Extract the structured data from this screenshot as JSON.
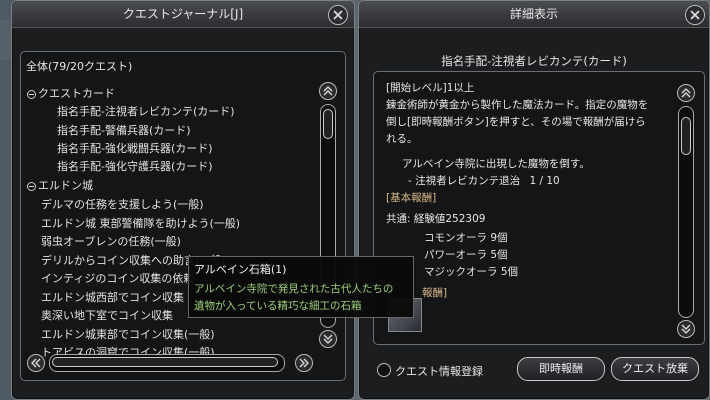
{
  "left_window": {
    "title": "クエストジャーナル[J]",
    "summary": "全体(79/20クエスト)",
    "groups": [
      {
        "label": "クエストカード",
        "items": [
          "指名手配-注視者レビカンテ(カード)",
          "指名手配-警備兵器(カード)",
          "指名手配-強化戦闘兵器(カード)",
          "指名手配-強化守護兵器(カード)"
        ]
      },
      {
        "label": "エルドン城",
        "items": [
          "デルマの任務を支援しよう(一般)",
          "エルドン城 東部警備隊を助けよう(一般)",
          "弱虫オーブレンの任務(一般)",
          "デリルからコイン収集への助言(一般)",
          "インティジのコイン収集の依頼",
          "エルドン城西部でコイン収集",
          "奥深い地下室でコイン収集",
          "エルドン城東部でコイン収集(一般)",
          "トアビスの洞窟でコイン収集(一般)"
        ]
      }
    ]
  },
  "tooltip": {
    "title": "アルベイン石箱(1)",
    "line1": "アルベイン寺院で発見された古代人たちの",
    "line2": "遺物が入っている精巧な細工の石箱"
  },
  "right_window": {
    "title": "詳細表示",
    "quest_title": "指名手配-注視者レビカンテ(カード)",
    "start_level": "[開始レベル]1以上",
    "desc_line1": "錬金術師が黄金から製作した魔法カード。指定の魔物を",
    "desc_line2": "倒し[即時報酬ボタン]を押すと、その場で報酬が届けら",
    "desc_line3": "れる。",
    "objective": "アルベイン寺院に出現した魔物を倒す。",
    "objective_sub": "- 注視者レビカンテ退治",
    "progress": "1 / 10",
    "basic_reward_header": "[基本報酬]",
    "common_exp": "共通: 経験値252309",
    "reward_items": [
      "コモンオーラ 9個",
      "パワーオーラ 5個",
      "マジックオーラ 5個"
    ],
    "partial_header": "報酬]",
    "register_label": "クエスト情報登録",
    "instant_reward_button": "即時報酬",
    "abandon_button": "クエスト放棄"
  },
  "colors": {
    "accent_gold": "#d8b98a",
    "tooltip_green": "#9bd07a",
    "window_bg": "#1c1d1f"
  },
  "icons": [
    "close-icon",
    "scroll-up-icon",
    "scroll-down-icon",
    "scroll-left-icon",
    "scroll-right-icon"
  ]
}
